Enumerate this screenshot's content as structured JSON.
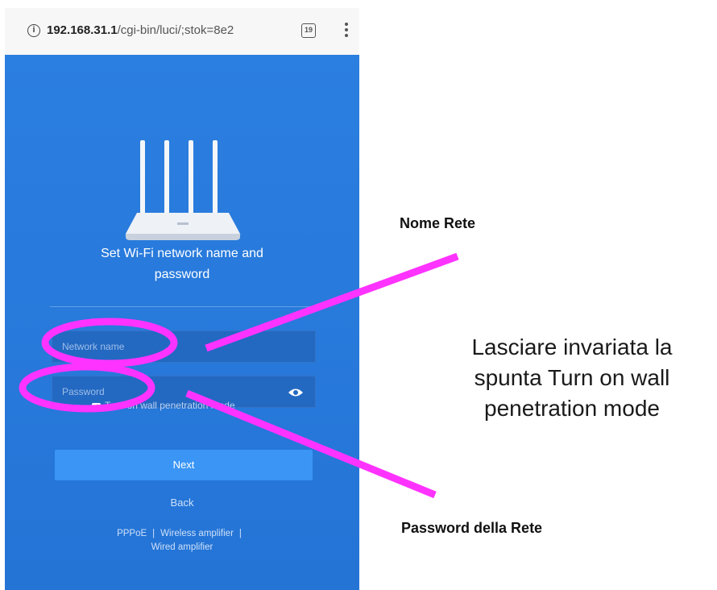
{
  "browser": {
    "url_host": "192.168.31.1",
    "url_path": "/cgi-bin/luci/;stok=8e2",
    "tab_count": "19",
    "info_icon": "info-icon",
    "menu_icon": "more-vert-icon"
  },
  "setup": {
    "heading_line1": "Set Wi-Fi network name and",
    "heading_line2": "password",
    "router_logo": "mi",
    "network_name_placeholder": "Network name",
    "password_placeholder": "Password",
    "wall_penetration_label": "Turn on wall penetration mode",
    "wall_penetration_checked": true,
    "next_label": "Next",
    "back_label": "Back",
    "footer_links": [
      "PPPoE",
      "Wireless amplifier",
      "Wired amplifier"
    ],
    "footer_separator": "|"
  },
  "annotations": {
    "network_name_label": "Nome Rete",
    "password_label": "Password della Rete",
    "note_line1": "Lasciare invariata la",
    "note_line2": "spunta Turn on wall",
    "note_line3": "penetration mode",
    "highlight_color": "#ff33ff"
  },
  "colors": {
    "page_blue": "#2474d6",
    "next_button": "#3a95f5"
  }
}
